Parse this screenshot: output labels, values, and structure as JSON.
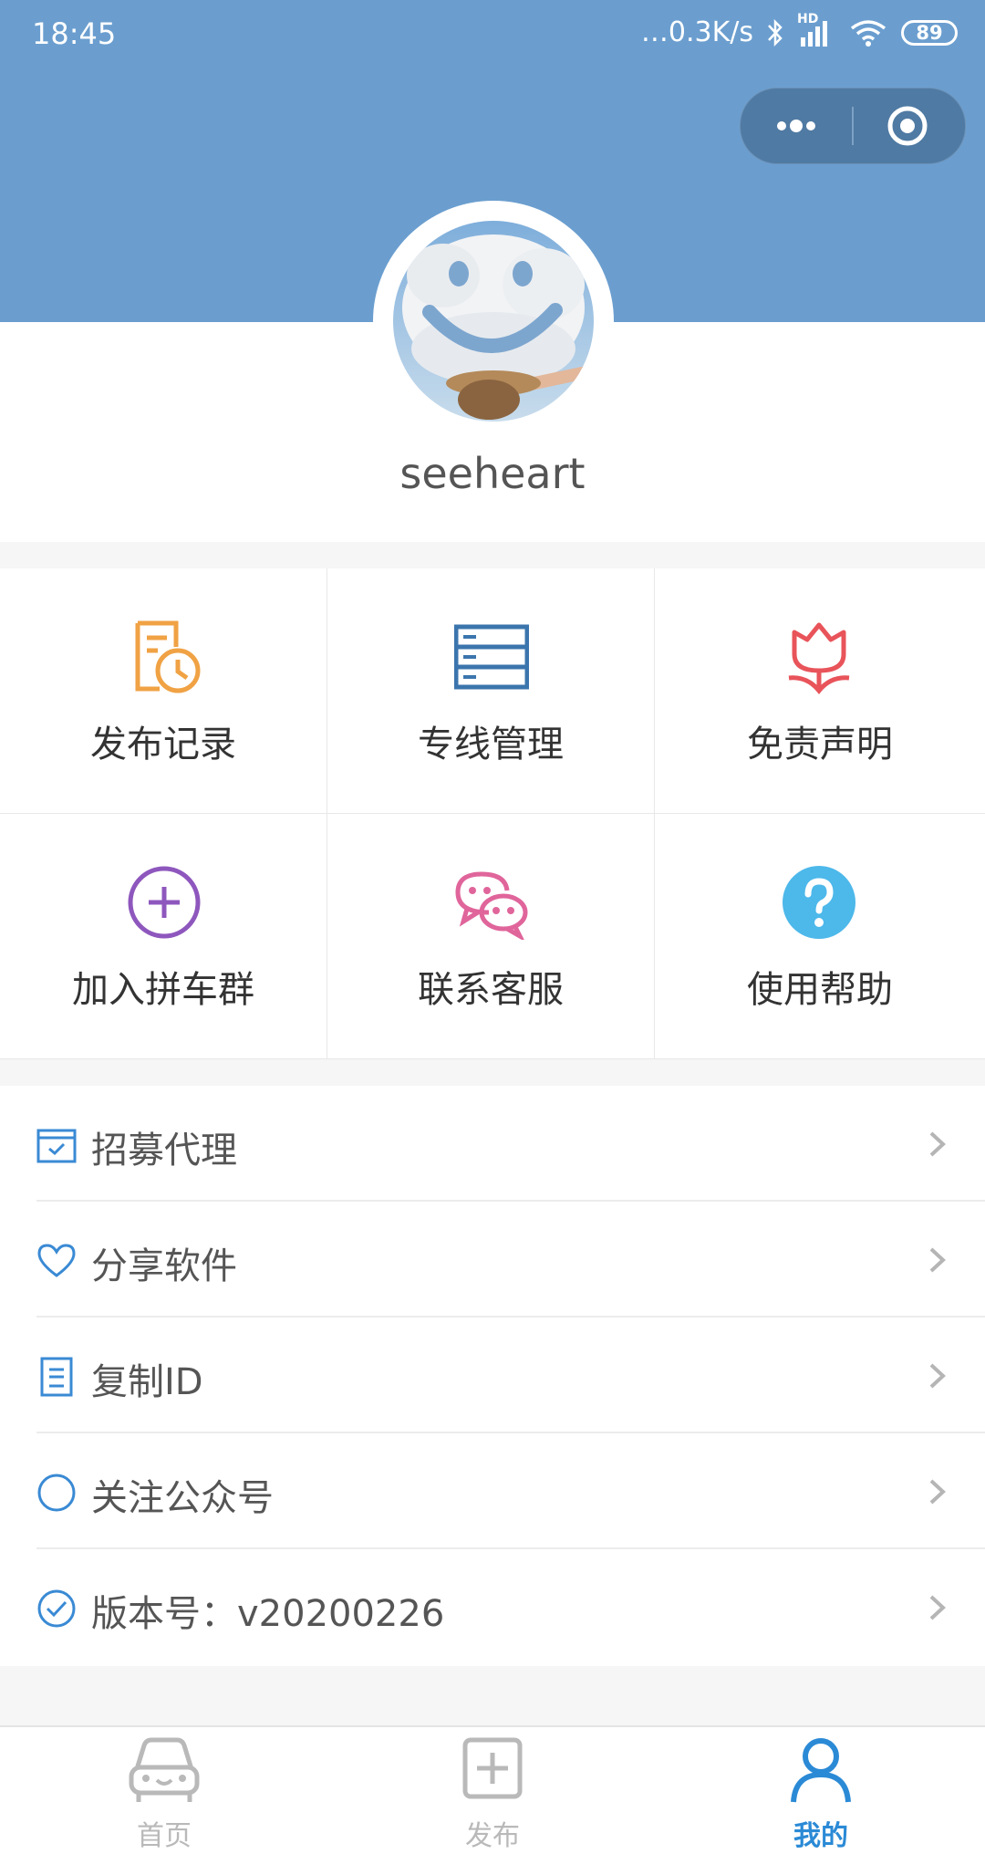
{
  "status_bar": {
    "time": "18:45",
    "network_speed": "…0.3K/s",
    "signal_label": "HD",
    "battery": "89"
  },
  "capsule": {
    "more_icon": "more-dots-icon",
    "close_icon": "target-close-icon"
  },
  "profile": {
    "username": "seeheart"
  },
  "grid": {
    "items": [
      {
        "label": "发布记录",
        "icon": "document-clock-icon",
        "color": "#f0a244"
      },
      {
        "label": "专线管理",
        "icon": "server-list-icon",
        "color": "#3b75ad"
      },
      {
        "label": "免责声明",
        "icon": "tulip-icon",
        "color": "#e8545a"
      },
      {
        "label": "加入拼车群",
        "icon": "plus-circle-icon",
        "color": "#8e57bd"
      },
      {
        "label": "联系客服",
        "icon": "chat-bubbles-icon",
        "color": "#e0659b"
      },
      {
        "label": "使用帮助",
        "icon": "question-circle-icon",
        "color": "#4db8ea"
      }
    ]
  },
  "menu": {
    "items": [
      {
        "label": "招募代理",
        "icon": "calendar-check-icon"
      },
      {
        "label": "分享软件",
        "icon": "heart-icon"
      },
      {
        "label": "复制ID",
        "icon": "clipboard-icon"
      },
      {
        "label": "关注公众号",
        "icon": "circle-icon"
      },
      {
        "label": "版本号：v20200226",
        "icon": "check-circle-icon"
      }
    ],
    "icon_color": "#3a8ad4"
  },
  "tabbar": {
    "tabs": [
      {
        "label": "首页",
        "icon": "car-icon",
        "active": false
      },
      {
        "label": "发布",
        "icon": "add-square-icon",
        "active": false
      },
      {
        "label": "我的",
        "icon": "user-icon",
        "active": true
      }
    ],
    "active_color": "#2b8ad6",
    "inactive_color": "#b9b9b9"
  }
}
